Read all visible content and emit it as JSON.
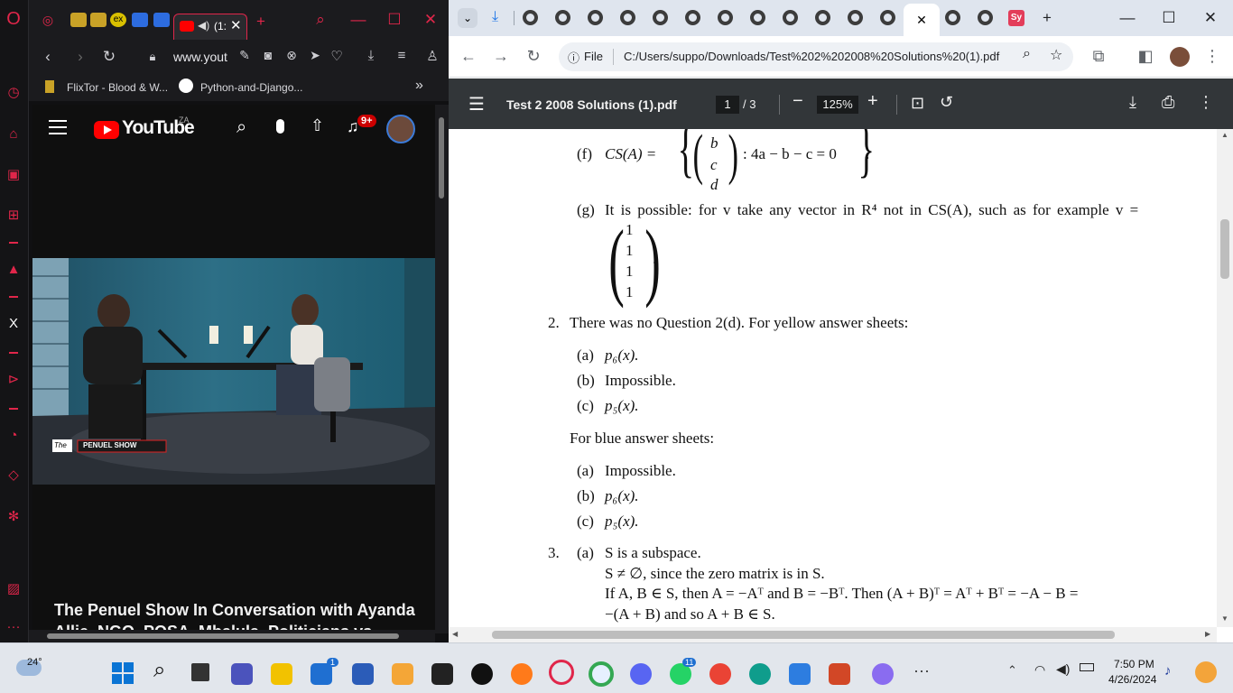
{
  "opera": {
    "tab_active_label": "(1:",
    "url": "www.yout",
    "bookmarks": [
      "FlixTor - Blood & W...",
      "Python-and-Django..."
    ],
    "yt_logo": "YouTube",
    "yt_region": "ZA",
    "notif_count": "9+",
    "video_title": "The Penuel Show In Conversation with Ayanda Allie, NGO, POSA, Mbalula, Politicians vs Bureaucrats",
    "video_watermark_the": "The",
    "video_watermark_show": "PENUEL SHOW"
  },
  "chrome": {
    "omnibox_scheme": "File",
    "omnibox_url": "C:/Users/suppo/Downloads/Test%202%202008%20Solutions%20(1).pdf",
    "tab_sy_label": "Sy",
    "pdf": {
      "filename": "Test 2 2008 Solutions (1).pdf",
      "page_current": "1",
      "page_total": "/ 3",
      "zoom": "125%"
    }
  },
  "doc": {
    "f_label": "(f)",
    "f_expr": "CS(A) =",
    "f_entries": [
      "b",
      "c",
      "d"
    ],
    "f_condition": ": 4a − b − c = 0",
    "f_end": ".",
    "g_label": "(g)",
    "g_text": "It is possible:  for v take any vector in R⁴ not in CS(A), such as for example v =",
    "g_vector": [
      "1",
      "1",
      "1",
      "1"
    ],
    "g_end": ".",
    "q2_num": "2.",
    "q2_text": "There was no Question 2(d).  For yellow answer sheets:",
    "yellow": [
      {
        "label": "(a)",
        "text": "p₆(x)."
      },
      {
        "label": "(b)",
        "text": "Impossible."
      },
      {
        "label": "(c)",
        "text": "p₅(x)."
      }
    ],
    "blue_heading": "For blue answer sheets:",
    "blue": [
      {
        "label": "(a)",
        "text": "Impossible."
      },
      {
        "label": "(b)",
        "text": "p₆(x)."
      },
      {
        "label": "(c)",
        "text": "p₅(x)."
      }
    ],
    "q3_num": "3.",
    "q3a_label": "(a)",
    "q3_lines": [
      "S is a subspace.",
      "S ≠ ∅, since the zero matrix is in S.",
      "If A, B ∈ S, then A = −Aᵀ and B = −Bᵀ. Then (A + B)ᵀ = Aᵀ + Bᵀ = −A − B =",
      "−(A + B) and so A + B ∈ S."
    ]
  },
  "taskbar": {
    "weather_temp": "24°",
    "time": "7:50 PM",
    "date": "4/26/2024",
    "badges": {
      "store": "1",
      "whatsapp": "11"
    }
  },
  "colors": {
    "opera_accent": "#e0264a",
    "chrome_tabstrip": "#dfe5ee",
    "pdf_toolbar": "#323639",
    "youtube_red": "#ff0000"
  }
}
